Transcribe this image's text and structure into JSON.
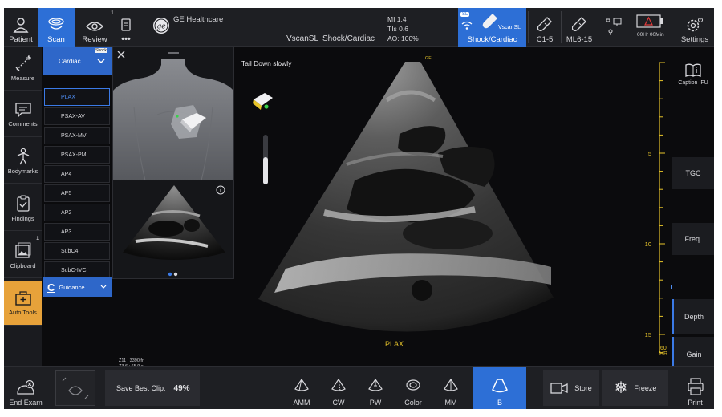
{
  "topbar": {
    "patient_label": "Patient",
    "scan_label": "Scan",
    "review_label": "Review",
    "review_badge": "1",
    "more_label": "•••",
    "brand": "GE Healthcare",
    "device": "VscanSL",
    "preset": "Shock/Cardiac",
    "mi": "MI 1.4",
    "tis": "TIs 0.6",
    "ao": "AO: 100%",
    "probe_active_badge": "SL",
    "probe_active_name": "VscanSL",
    "probe_active_label": "Shock/Cardiac",
    "probe2_label": "C1-5",
    "probe3_label": "ML6-15",
    "battery_time": "00Hr 00Min",
    "settings_label": "Settings"
  },
  "lefttools": {
    "measure": "Measure",
    "comments": "Comments",
    "bodymarks": "Bodymarks",
    "findings": "Findings",
    "clipboard": "Clipboard",
    "clipboard_badge": "1",
    "autotools": "Auto Tools"
  },
  "viewlist": {
    "header": "Cardiac",
    "header_tag": "Shock",
    "items": [
      "PLAX",
      "PSAX-AV",
      "PSAX-MV",
      "PSAX-PM",
      "AP4",
      "AP5",
      "AP2",
      "AP3",
      "SubC4",
      "SubC-IVC"
    ],
    "selected": "PLAX",
    "guidance": "Guidance"
  },
  "image": {
    "hint": "Tail Down slowly",
    "orientation_marker": "GF",
    "view_label": "PLAX",
    "frame_info_1": "Z11 : 3390 fr",
    "frame_info_2": "Z3.6 : 65.9 s",
    "hr_value": "60",
    "hr_label": "HR",
    "depth_ticks": [
      "5",
      "10",
      "15"
    ]
  },
  "rightcol": {
    "caption": "Caption IFU",
    "tgc": "TGC",
    "freq": "Freq.",
    "depth": "Depth",
    "gain": "Gain"
  },
  "bottombar": {
    "end_exam": "End Exam",
    "save_best_clip_label": "Save Best Clip:",
    "save_best_clip_value": "49%",
    "modes": [
      "AMM",
      "CW",
      "PW",
      "Color",
      "MM",
      "B"
    ],
    "active_mode": "B",
    "store": "Store",
    "freeze": "Freeze",
    "print": "Print"
  },
  "colors": {
    "accent": "#2d6fd6",
    "orange": "#e7a23a",
    "yellow": "#e8c52a",
    "panel_bg": "#1e1f23"
  }
}
